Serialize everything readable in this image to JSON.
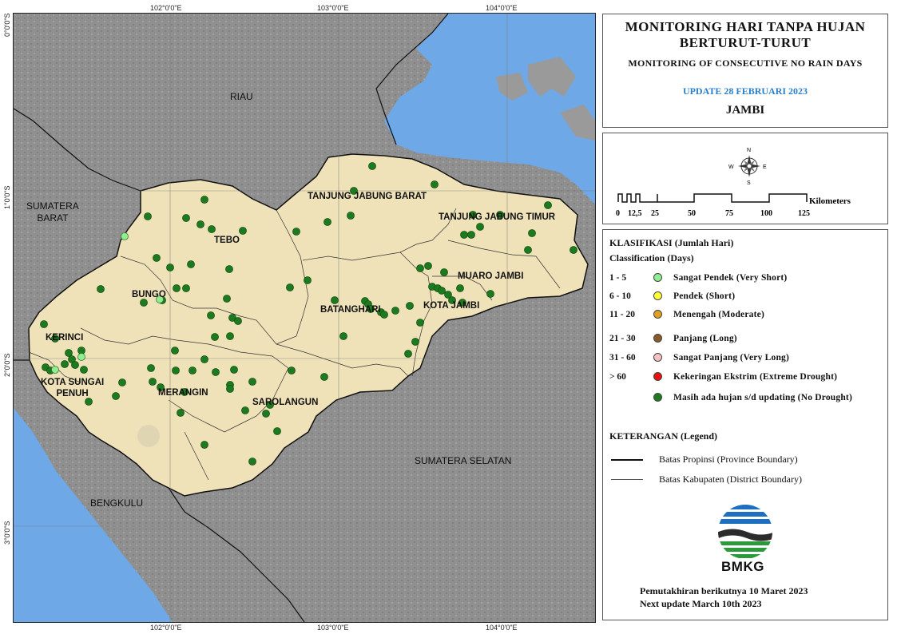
{
  "title": {
    "line1": "MONITORING HARI TANPA HUJAN",
    "line2": "BERTURUT-TURUT",
    "english": "MONITORING OF CONSECUTIVE NO RAIN DAYS",
    "update": "UPDATE 28 FEBRUARI 2023",
    "province": "JAMBI"
  },
  "coordinates": {
    "top_lon": [
      "102°0'0\"E",
      "103°0'0\"E",
      "104°0'0\"E"
    ],
    "bottom_lon": [
      "102°0'0\"E",
      "103°0'0\"E",
      "104°0'0\"E"
    ],
    "left_lat": [
      "0°0'0\"S",
      "1°0'0\"S",
      "2°0'0\"S",
      "3°0'0\"S"
    ]
  },
  "scale_bar": {
    "unit": "Kilometers",
    "ticks": [
      "0",
      "12,5",
      "25",
      "50",
      "75",
      "100",
      "125"
    ],
    "north_arrow": {
      "n": "N",
      "s": "S",
      "e": "E",
      "w": "W"
    }
  },
  "classification": {
    "heading": "KLASIFIKASI (Jumlah Hari)",
    "heading_en": "Classification (Days)",
    "classes": [
      {
        "range": "1 - 5",
        "label": "Sangat Pendek  (Very Short)",
        "color": "#90ee90"
      },
      {
        "range": "6 - 10",
        "label": "Pendek  (Short)",
        "color": "#ffff33"
      },
      {
        "range": "11 - 20",
        "label": "Menengah  (Moderate)",
        "color": "#e0a020"
      },
      {
        "range": "21 - 30",
        "label": "Panjang  (Long)",
        "color": "#8b5a2b"
      },
      {
        "range": "31 - 60",
        "label": "Sangat Panjang  (Very Long)",
        "color": "#f4c2c2"
      },
      {
        "range": "> 60",
        "label": "Kekeringan Ekstrim  (Extreme Drought)",
        "color": "#e81010"
      },
      {
        "range": "",
        "label": "Masih ada hujan s/d updating  (No Drought)",
        "color": "#1e7a1e"
      }
    ]
  },
  "legend": {
    "heading": "KETERANGAN  (Legend)",
    "province_boundary": "Batas Propinsi (Province Boundary)",
    "district_boundary": "Batas Kabupaten (District Boundary)"
  },
  "logo": {
    "text": "BMKG"
  },
  "next_update": {
    "line1": "Pemutakhiran berikutnya 10 Maret 2023",
    "line2": "Next update March 10th 2023"
  },
  "map_labels": {
    "regions": {
      "riau": "RIAU",
      "sumbar": "SUMATERA\nBARAT",
      "sumsel": "SUMATERA SELATAN",
      "bengkulu": "BENGKULU"
    },
    "districts": {
      "tanjabbar": "TANJUNG JABUNG BARAT",
      "tanjabtim": "TANJUNG JABUNG TIMUR",
      "tebo": "TEBO",
      "bungo": "BUNGO",
      "kerinci": "KERINCI",
      "kotasungaipenuh": "KOTA SUNGAI\nPENUH",
      "merangin": "MERANGIN",
      "sarolangun": "SAROLANGUN",
      "batanghari": "BATANGHARI",
      "muarojambi": "MUARO JAMBI",
      "kotajambi": "KOTA JAMBI"
    }
  },
  "stations": {
    "green": [
      [
        465,
        207
      ],
      [
        543,
        230
      ],
      [
        442,
        238
      ],
      [
        255,
        249
      ],
      [
        184,
        270
      ],
      [
        232,
        272
      ],
      [
        250,
        280
      ],
      [
        264,
        286
      ],
      [
        303,
        288
      ],
      [
        370,
        289
      ],
      [
        409,
        277
      ],
      [
        438,
        269
      ],
      [
        591,
        268
      ],
      [
        625,
        268
      ],
      [
        685,
        256
      ],
      [
        600,
        283
      ],
      [
        580,
        293
      ],
      [
        589,
        293
      ],
      [
        665,
        291
      ],
      [
        717,
        312
      ],
      [
        660,
        312
      ],
      [
        195,
        322
      ],
      [
        212,
        334
      ],
      [
        238,
        330
      ],
      [
        286,
        336
      ],
      [
        232,
        360
      ],
      [
        220,
        360
      ],
      [
        125,
        361
      ],
      [
        362,
        359
      ],
      [
        384,
        350
      ],
      [
        525,
        335
      ],
      [
        535,
        332
      ],
      [
        555,
        340
      ],
      [
        540,
        358
      ],
      [
        547,
        360
      ],
      [
        552,
        363
      ],
      [
        575,
        360
      ],
      [
        560,
        368
      ],
      [
        565,
        375
      ],
      [
        578,
        378
      ],
      [
        613,
        367
      ],
      [
        418,
        375
      ],
      [
        456,
        376
      ],
      [
        460,
        380
      ],
      [
        463,
        386
      ],
      [
        476,
        390
      ],
      [
        480,
        393
      ],
      [
        494,
        388
      ],
      [
        512,
        382
      ],
      [
        525,
        403
      ],
      [
        283,
        373
      ],
      [
        179,
        378
      ],
      [
        202,
        375
      ],
      [
        263,
        394
      ],
      [
        290,
        397
      ],
      [
        297,
        401
      ],
      [
        54,
        405
      ],
      [
        68,
        423
      ],
      [
        101,
        438
      ],
      [
        85,
        441
      ],
      [
        268,
        421
      ],
      [
        218,
        438
      ],
      [
        287,
        420
      ],
      [
        519,
        427
      ],
      [
        510,
        442
      ],
      [
        429,
        420
      ],
      [
        56,
        459
      ],
      [
        62,
        463
      ],
      [
        80,
        455
      ],
      [
        89,
        449
      ],
      [
        93,
        456
      ],
      [
        104,
        462
      ],
      [
        255,
        449
      ],
      [
        240,
        463
      ],
      [
        219,
        463
      ],
      [
        269,
        465
      ],
      [
        292,
        462
      ],
      [
        364,
        463
      ],
      [
        405,
        471
      ],
      [
        315,
        477
      ],
      [
        152,
        478
      ],
      [
        190,
        477
      ],
      [
        188,
        460
      ],
      [
        144,
        495
      ],
      [
        200,
        484
      ],
      [
        230,
        490
      ],
      [
        287,
        481
      ],
      [
        287,
        486
      ],
      [
        110,
        502
      ],
      [
        225,
        516
      ],
      [
        306,
        513
      ],
      [
        332,
        517
      ],
      [
        337,
        506
      ],
      [
        346,
        539
      ],
      [
        255,
        556
      ],
      [
        315,
        577
      ]
    ],
    "lightgreen": [
      [
        155,
        295
      ],
      [
        199,
        374
      ],
      [
        101,
        446
      ],
      [
        68,
        462
      ]
    ]
  }
}
